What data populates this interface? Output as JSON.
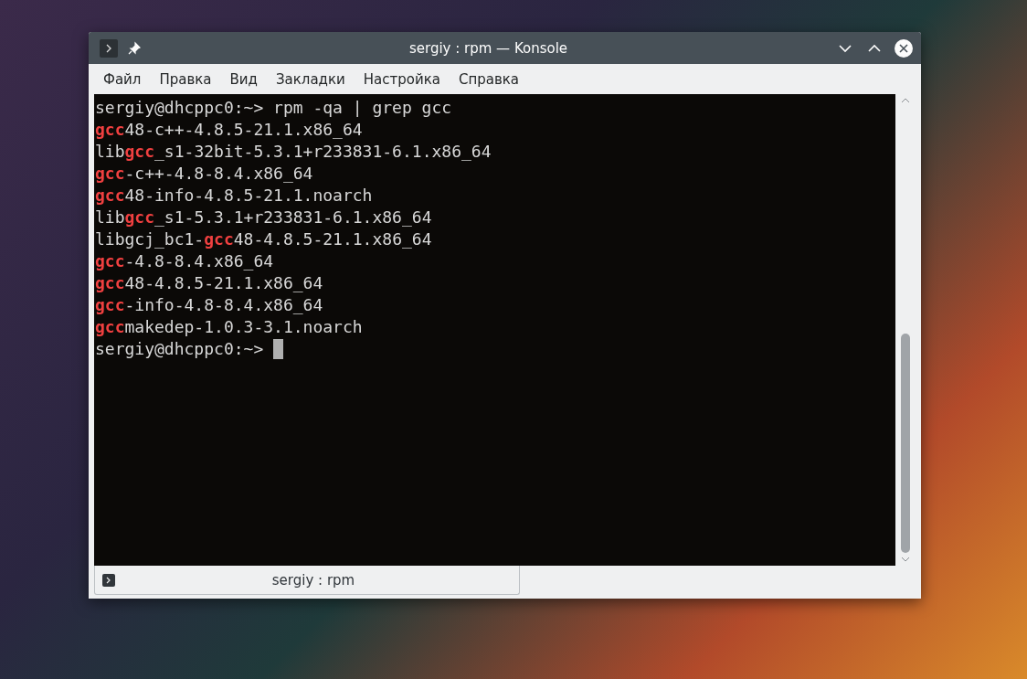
{
  "window": {
    "title": "sergiy : rpm — Konsole"
  },
  "menu": [
    "Файл",
    "Правка",
    "Вид",
    "Закладки",
    "Настройка",
    "Справка"
  ],
  "terminal": {
    "lines": [
      "sergiy@dhcppc0:~> rpm -qa | grep gcc",
      "**gcc**48-c++-4.8.5-21.1.x86_64",
      "lib**gcc**_s1-32bit-5.3.1+r233831-6.1.x86_64",
      "**gcc**-c++-4.8-8.4.x86_64",
      "**gcc**48-info-4.8.5-21.1.noarch",
      "lib**gcc**_s1-5.3.1+r233831-6.1.x86_64",
      "libgcj_bc1-**gcc**48-4.8.5-21.1.x86_64",
      "**gcc**-4.8-8.4.x86_64",
      "**gcc**48-4.8.5-21.1.x86_64",
      "**gcc**-info-4.8-8.4.x86_64",
      "**gcc**makedep-1.0.3-3.1.noarch"
    ],
    "prompt": "sergiy@dhcppc0:~>"
  },
  "tabs": [
    {
      "label": "sergiy : rpm",
      "selected": true
    }
  ]
}
